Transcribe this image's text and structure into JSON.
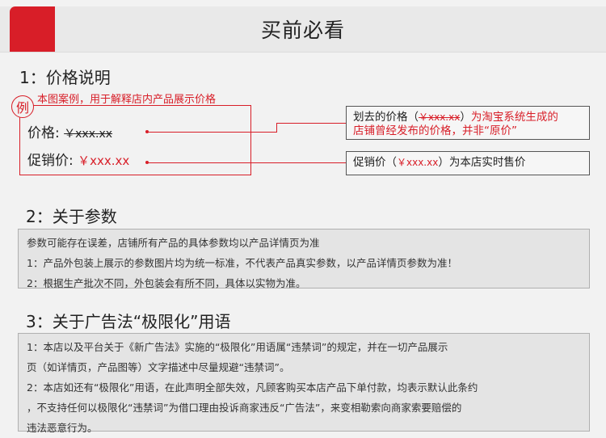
{
  "header": {
    "title": "买前必看"
  },
  "section1": {
    "title": "1：价格说明",
    "example_badge": "例",
    "example_caption": "本图案例，用于解释店内产品展示价格",
    "price_label": "价格:",
    "price_value": "￥xxx.xx",
    "promo_label": "促销价:",
    "promo_value": "￥xxx.xx",
    "note_strike": {
      "prefix": "划去的价格（",
      "value": "￥xxx.xx",
      "suffix": "）",
      "red_text_1": "为淘宝系统生成的",
      "red_text_2": "店铺曾经发布的价格，并非“原价”"
    },
    "note_promo": {
      "prefix": "促销价（",
      "value": "￥xxx.xx",
      "suffix": "）为本店实时售价"
    }
  },
  "section2": {
    "title": "2：关于参数",
    "lines": [
      "参数可能存在误差，店铺所有产品的具体参数均以产品详情页为准",
      "1：产品外包装上展示的参数图片均为统一标准，不代表产品真实参数，以产品详情页参数为准！",
      "2：根据生产批次不同，外包装会有所不同，具体以实物为准。"
    ]
  },
  "section3": {
    "title": "3：关于广告法“极限化”用语",
    "lines": [
      "1：本店以及平台关于《新广告法》实施的“极限化”用语属“违禁词”的规定，并在一切产品展示",
      "页（如详情页，产品图等）文字描述中尽量规避“违禁词”。",
      "2：本店如还有“极限化”用语，在此声明全部失效，凡顾客购买本店产品下单付款，均表示默认此条约",
      "，不支持任何以极限化“违禁词”为借口理由投诉商家违反“广告法”，来变相勒索向商家索要赔偿的",
      "违法恶意行为。"
    ]
  },
  "colors": {
    "accent": "#d81e28",
    "background": "#f2f2f2",
    "box": "#e4e4e4"
  }
}
